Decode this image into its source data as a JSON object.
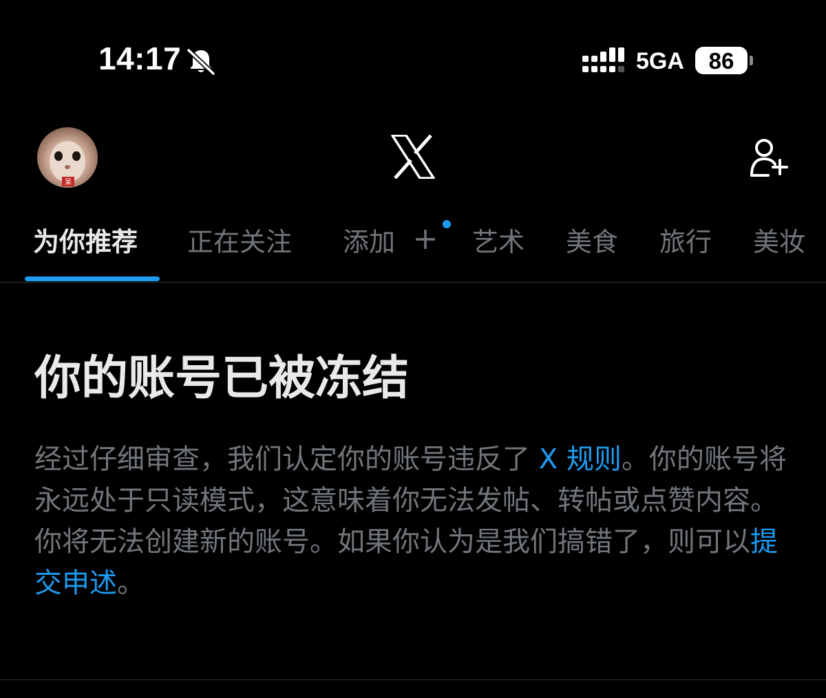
{
  "status_bar": {
    "time": "14:17",
    "network": "5GA",
    "battery": "86",
    "icons": [
      "bell-off-icon",
      "signal-icon"
    ]
  },
  "header": {
    "logo": "X",
    "avatar_badge": "呆",
    "icons": [
      "avatar",
      "x-logo-icon",
      "add-user-icon"
    ]
  },
  "tabs": [
    {
      "label": "为你推荐",
      "active": true
    },
    {
      "label": "正在关注",
      "active": false
    },
    {
      "label": "添加",
      "active": false
    },
    {
      "label": "艺术",
      "active": false
    },
    {
      "label": "美食",
      "active": false
    },
    {
      "label": "旅行",
      "active": false
    },
    {
      "label": "美妆",
      "active": false
    }
  ],
  "notice": {
    "title": "你的账号已被冻结",
    "body_part1": "经过仔细审查，我们认定你的账号违反了 ",
    "rules_link": "X 规则",
    "body_part2": "。你的账号将永远处于只读模式，这意味着你无法发帖、转帖或点赞内容。你将无法创建新的账号。如果你认为是我们搞错了，则可以",
    "appeal_link": "提交申述",
    "body_part3": "。"
  },
  "colors": {
    "background": "#000000",
    "accent": "#1d9bf0",
    "text_primary": "#e7e9ea",
    "text_secondary": "#71767b",
    "divider": "#2f3336"
  }
}
